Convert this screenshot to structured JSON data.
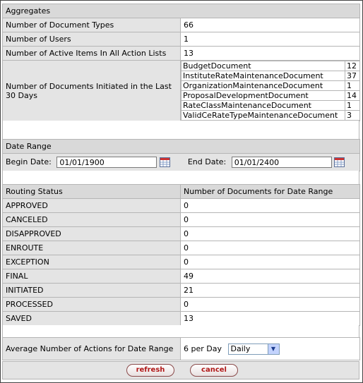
{
  "aggregates": {
    "title": "Aggregates",
    "doc_types_label": "Number of Document Types",
    "doc_types_value": "66",
    "users_label": "Number of Users",
    "users_value": "1",
    "active_items_label": "Number of Active Items In All Action Lists",
    "active_items_value": "13",
    "initiated_label": "Number of Documents Initiated in the Last 30 Days",
    "initiated_docs": [
      {
        "name": "BudgetDocument",
        "count": "12"
      },
      {
        "name": "InstituteRateMaintenanceDocument",
        "count": "37"
      },
      {
        "name": "OrganizationMaintenanceDocument",
        "count": "1"
      },
      {
        "name": "ProposalDevelopmentDocument",
        "count": "14"
      },
      {
        "name": "RateClassMaintenanceDocument",
        "count": "1"
      },
      {
        "name": "ValidCeRateTypeMaintenanceDocument",
        "count": "3"
      }
    ]
  },
  "date_range": {
    "title": "Date Range",
    "begin_label": "Begin Date:",
    "begin_value": "01/01/1900",
    "end_label": "End Date:",
    "end_value": "01/01/2400"
  },
  "routing": {
    "status_header": "Routing Status",
    "count_header": "Number of Documents for Date Range",
    "rows": [
      {
        "status": "APPROVED",
        "count": "0"
      },
      {
        "status": "CANCELED",
        "count": "0"
      },
      {
        "status": "DISAPPROVED",
        "count": "0"
      },
      {
        "status": "ENROUTE",
        "count": "0"
      },
      {
        "status": "EXCEPTION",
        "count": "0"
      },
      {
        "status": "FINAL",
        "count": "49"
      },
      {
        "status": "INITIATED",
        "count": "21"
      },
      {
        "status": "PROCESSED",
        "count": "0"
      },
      {
        "status": "SAVED",
        "count": "13"
      }
    ]
  },
  "average": {
    "label": "Average Number of Actions for Date Range",
    "value": "6 per Day",
    "period": "Daily"
  },
  "buttons": {
    "refresh": "refresh",
    "cancel": "cancel"
  },
  "icons": {
    "calendar": "calendar-icon",
    "dropdown": "chevron-down-icon"
  }
}
